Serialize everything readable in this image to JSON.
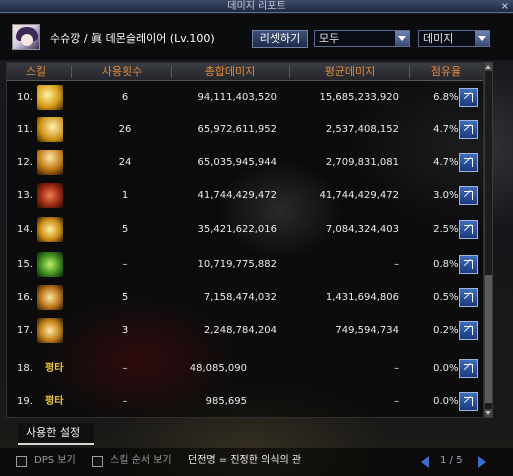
{
  "window": {
    "title": "데미지 리포트",
    "close_glyph": "×"
  },
  "header": {
    "character_name": "수슈깡",
    "separator": "/",
    "character_class": "眞 데몬슬레이어 (Lv.100)",
    "reset_label": "리셋하기",
    "filter_select": "모두",
    "sort_select": "데미지"
  },
  "table": {
    "columns": [
      "스킬",
      "사용횟수",
      "총합데미지",
      "평균데미지",
      "점유율"
    ],
    "rows": [
      {
        "index": "10.",
        "skill_icon": "skill-icon-slash",
        "uses": "6",
        "total": "94,111,403,520",
        "average": "15,685,233,920",
        "share": "6.8",
        "share_unit": "%"
      },
      {
        "index": "11.",
        "skill_icon": "skill-icon-crescent",
        "uses": "26",
        "total": "65,972,611,952",
        "average": "2,537,408,152",
        "share": "4.7",
        "share_unit": "%"
      },
      {
        "index": "12.",
        "skill_icon": "skill-icon-spikes",
        "uses": "24",
        "total": "65,035,945,944",
        "average": "2,709,831,081",
        "share": "4.7",
        "share_unit": "%"
      },
      {
        "index": "13.",
        "skill_icon": "skill-icon-demon",
        "uses": "1",
        "total": "41,744,429,472",
        "average": "41,744,429,472",
        "share": "3.0",
        "share_unit": "%"
      },
      {
        "index": "14.",
        "skill_icon": "skill-icon-vortex",
        "uses": "5",
        "total": "35,421,622,016",
        "average": "7,084,324,403",
        "share": "2.5",
        "share_unit": "%"
      },
      {
        "index": "15.",
        "skill_icon": "skill-icon-green-aura",
        "uses": "–",
        "total": "10,719,775,882",
        "average": "–",
        "share": "0.8",
        "share_unit": "%"
      },
      {
        "index": "16.",
        "skill_icon": "skill-icon-wave",
        "uses": "5",
        "total": "7,158,474,032",
        "average": "1,431,694,806",
        "share": "0.5",
        "share_unit": "%"
      },
      {
        "index": "17.",
        "skill_icon": "skill-icon-crescent-gold",
        "uses": "3",
        "total": "2,248,784,204",
        "average": "749,594,734",
        "share": "0.2",
        "share_unit": "%"
      },
      {
        "index": "18.",
        "skill_label": "평타",
        "uses": "–",
        "total": "48,085,090",
        "average": "–",
        "share": "0.0",
        "share_unit": "%"
      },
      {
        "index": "19.",
        "skill_label": "평타",
        "uses": "–",
        "total": "985,695",
        "average": "–",
        "share": "0.0",
        "share_unit": "%"
      }
    ]
  },
  "settings_tab": "사용한 설정",
  "bottom": {
    "dps_toggle": "DPS 보기",
    "skill_order_toggle": "스킬 순서 보기",
    "title_label": "던전명 = 진정한 의식의 관",
    "pager": "1 / 5"
  },
  "colors": {
    "header_text": "#e28a3a",
    "accent_blue": "#3a6fd0",
    "basic_attack_label": "#f0c43c"
  }
}
